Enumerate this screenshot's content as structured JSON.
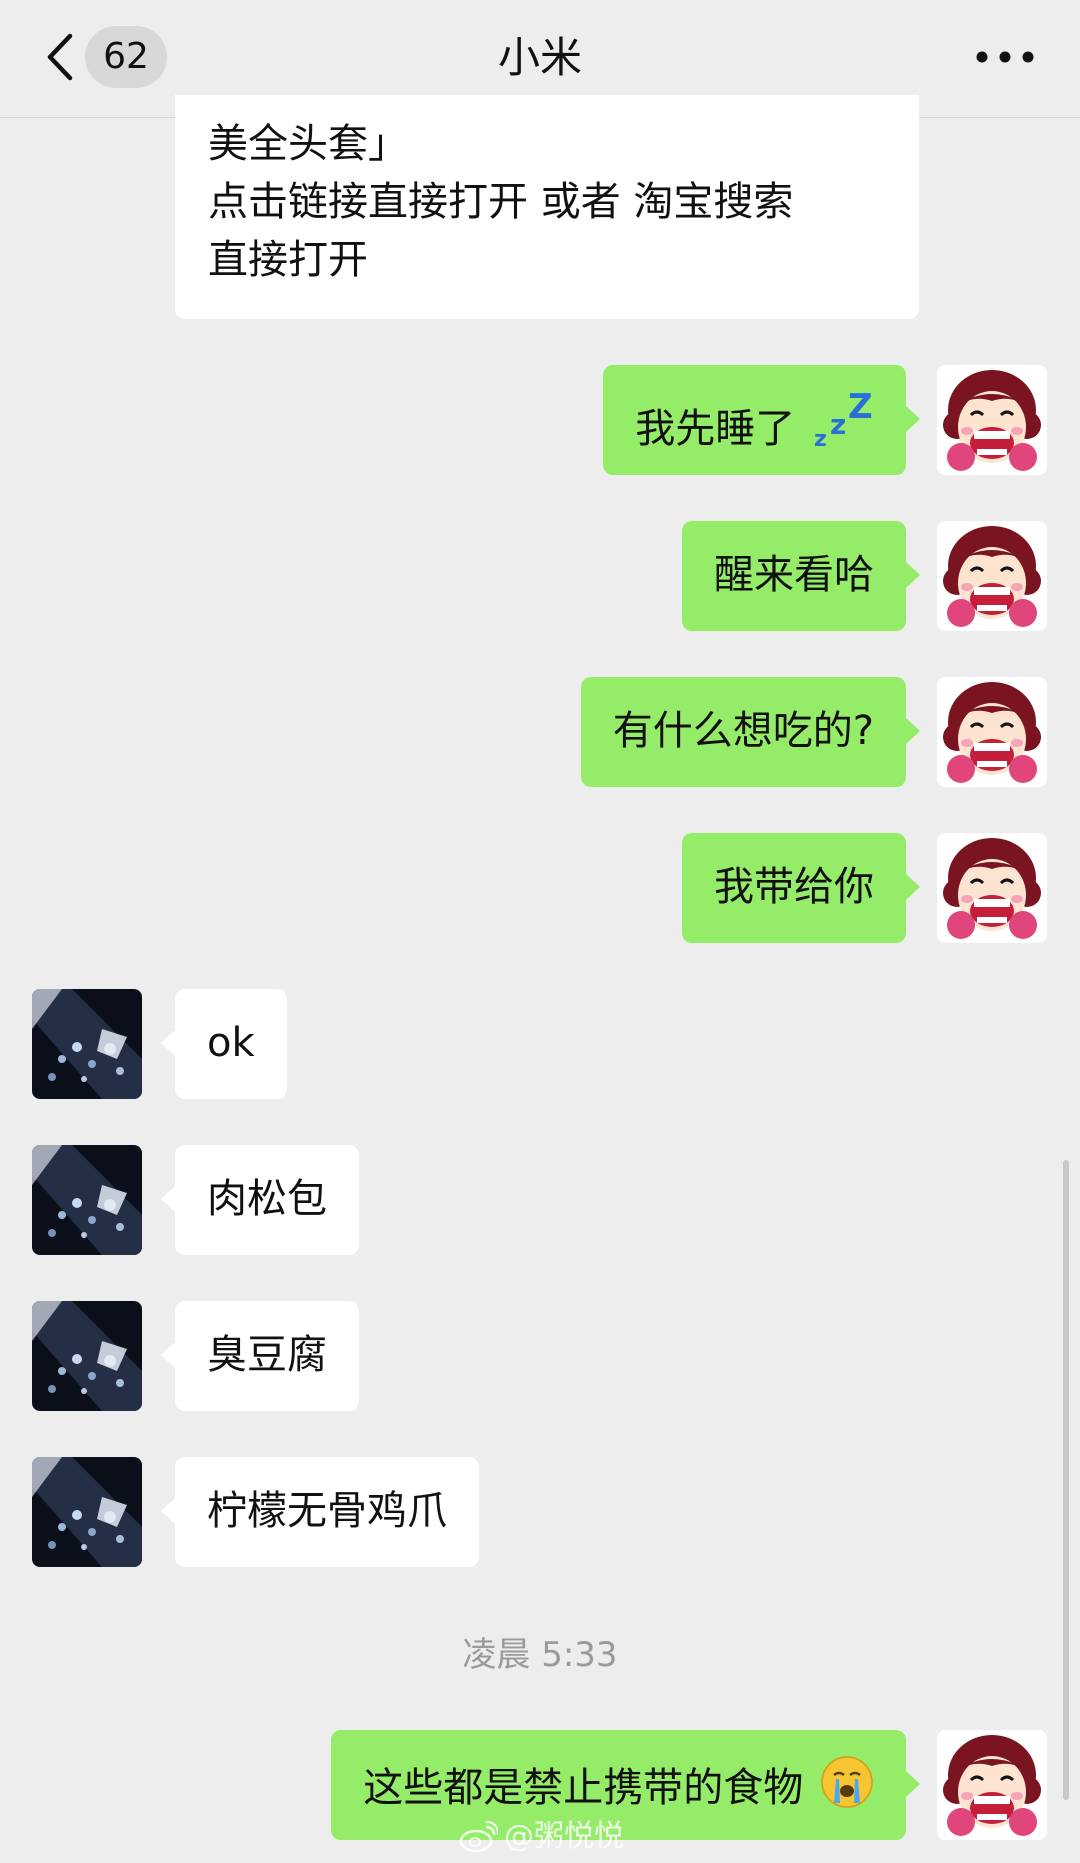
{
  "header": {
    "unread_count": "62",
    "title": "小米",
    "back_icon": "chevron-left-icon",
    "more_icon": "more-dots-icon"
  },
  "messages": [
    {
      "side": "in",
      "lines": [
        "美全头套」",
        "点击链接直接打开 或者 淘宝搜索",
        "直接打开"
      ]
    },
    {
      "side": "out",
      "text": "我先睡了",
      "emoji": "zzz-sleep-emoji"
    },
    {
      "side": "out",
      "text": "醒来看哈"
    },
    {
      "side": "out",
      "text": "有什么想吃的?"
    },
    {
      "side": "out",
      "text": "我带给你"
    },
    {
      "side": "in",
      "text": "ok"
    },
    {
      "side": "in",
      "text": "肉松包"
    },
    {
      "side": "in",
      "text": "臭豆腐"
    },
    {
      "side": "in",
      "text": "柠檬无骨鸡爪"
    },
    {
      "side": "out",
      "text": "这些都是禁止携带的食物",
      "emoji": "crying-face-emoji"
    }
  ],
  "timestamp": "凌晨 5:33",
  "watermark": "@粥悦悦",
  "colors": {
    "background": "#ededed",
    "incoming_bubble": "#ffffff",
    "outgoing_bubble": "#95ec69",
    "timestamp_text": "#9a9a9a"
  }
}
